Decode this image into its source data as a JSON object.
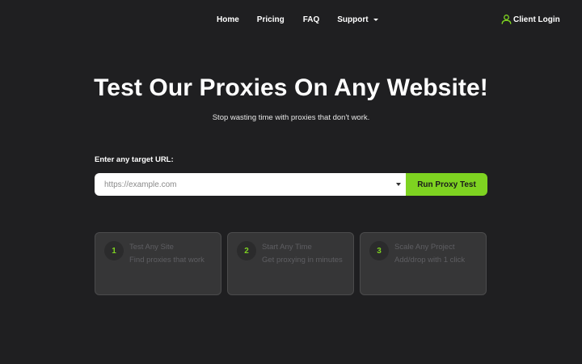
{
  "nav": {
    "links": [
      {
        "label": "Home"
      },
      {
        "label": "Pricing"
      },
      {
        "label": "FAQ"
      },
      {
        "label": "Support",
        "has_dropdown": true
      }
    ],
    "client_login": {
      "label": "Client Login",
      "icon": "user-icon"
    }
  },
  "hero": {
    "title": "Test Our Proxies On Any Website!",
    "subtitle": "Stop wasting time with proxies that don't work."
  },
  "url_test": {
    "label": "Enter any target URL:",
    "input_value": "",
    "placeholder": "https://example.com",
    "button_label": "Run Proxy Test"
  },
  "features": [
    {
      "number": "1",
      "title": "Test Any Site",
      "description": "Find proxies that work"
    },
    {
      "number": "2",
      "title": "Start Any Time",
      "description": "Get proxying in minutes"
    },
    {
      "number": "3",
      "title": "Scale Any Project",
      "description": "Add/drop with 1 click"
    }
  ],
  "colors": {
    "background": "#1f1f21",
    "accent": "#7ed321",
    "card_background": "#363637",
    "card_text": "#5e5e62"
  }
}
